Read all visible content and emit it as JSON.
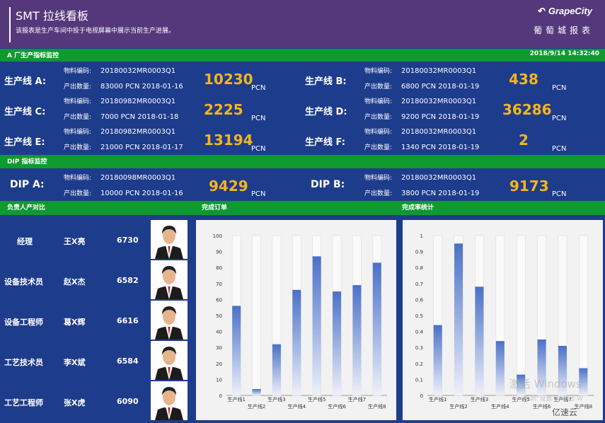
{
  "header": {
    "title": "SMT 拉线看板",
    "subtitle": "该报表是生产车间中投于电视屏幕中展示当前生产进展。",
    "logo": "GrapeCity",
    "brand": "葡萄城报表"
  },
  "sections": {
    "a_title": "A 厂生产指标监控",
    "datetime": "2018/9/14 14:32:40",
    "dip_title": "DIP 指标监控",
    "person_title": "负责人产对比",
    "orders_title": "完成订单",
    "rate_title": "完成率统计"
  },
  "labels": {
    "material": "物料编码:",
    "output": "产出数量:"
  },
  "lines": [
    {
      "name": "生产线 A:",
      "code": "20180032MR0003Q1",
      "qty": "83000 PCN 2018-01-16",
      "value": "10230",
      "unit": "PCN"
    },
    {
      "name": "生产线 B:",
      "code": "20180032MR0003Q1",
      "qty": "6800  PCN 2018-01-19",
      "value": "438",
      "unit": "PCN"
    },
    {
      "name": "生产线 C:",
      "code": "20180982MR0003Q1",
      "qty": "7000  PCN 2018-01-18",
      "value": "2225",
      "unit": "PCN"
    },
    {
      "name": "生产线 D:",
      "code": "20180032MR0003Q1",
      "qty": "9200  PCN 2018-01-19",
      "value": "36286",
      "unit": "PCN"
    },
    {
      "name": "生产线 E:",
      "code": "20180982MR0003Q1",
      "qty": "21000  PCN 2018-01-17",
      "value": "13194",
      "unit": "PCN"
    },
    {
      "name": "生产线 F:",
      "code": "20180032MR0003Q1",
      "qty": "1340  PCN 2018-01-19",
      "value": "2",
      "unit": "PCN"
    }
  ],
  "dip": [
    {
      "name": "DIP A:",
      "code": "20180098MR0003Q1",
      "qty": "10000 PCN 2018-01-16",
      "value": "9429",
      "unit": "PCN"
    },
    {
      "name": "DIP B:",
      "code": "20180032MR0003Q1",
      "qty": "3800  PCN 2018-01-19",
      "value": "9173",
      "unit": "PCN"
    }
  ],
  "people": [
    {
      "role": "经理",
      "name": "王X亮",
      "score": "6730"
    },
    {
      "role": "设备技术员",
      "name": "赵X杰",
      "score": "6582"
    },
    {
      "role": "设备工程师",
      "name": "葛X辉",
      "score": "6616"
    },
    {
      "role": "工艺技术员",
      "name": "李X斌",
      "score": "6584"
    },
    {
      "role": "工艺工程师",
      "name": "张X虎",
      "score": "6090"
    }
  ],
  "watermark": {
    "line1": "激活 Windows",
    "line2": "转到“设置”以激活 W",
    "yisu": "亿速云"
  },
  "chart_data": [
    {
      "type": "bar",
      "categories": [
        "生产线1",
        "生产线2",
        "生产线3",
        "生产线4",
        "生产线5",
        "生产线6",
        "生产线7",
        "生产线8"
      ],
      "values": [
        56,
        4,
        32,
        66,
        87,
        65,
        69,
        83
      ],
      "ylim": [
        0,
        100
      ],
      "yticks": [
        "0",
        "10",
        "20",
        "30",
        "40",
        "50",
        "60",
        "70",
        "80",
        "90",
        "100"
      ],
      "title": ""
    },
    {
      "type": "bar",
      "categories": [
        "生产线1",
        "生产线2",
        "生产线3",
        "生产线4",
        "生产线5",
        "生产线6",
        "生产线7",
        "生产线8"
      ],
      "values": [
        0.44,
        0.95,
        0.68,
        0.34,
        0.13,
        0.35,
        0.31,
        0.17
      ],
      "ylim": [
        0,
        1
      ],
      "yticks": [
        "0",
        "0.1",
        "0.2",
        "0.3",
        "0.4",
        "0.5",
        "0.6",
        "0.7",
        "0.8",
        "0.9",
        "1"
      ],
      "title": ""
    }
  ],
  "colors": {
    "header": "#55387c",
    "body": "#1e3c8c",
    "green": "#0f9a2f",
    "value": "#f5b51c",
    "bar": "#4a70c8"
  }
}
